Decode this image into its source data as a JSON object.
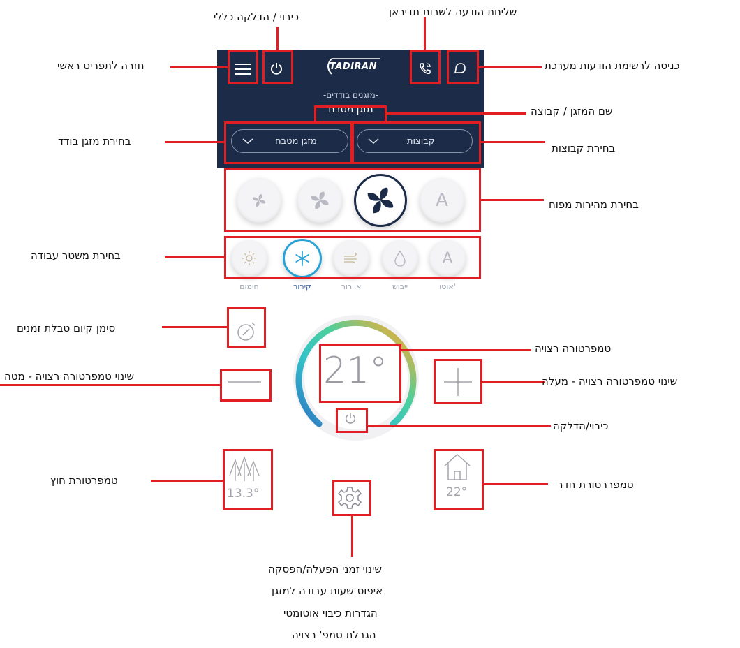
{
  "header": {
    "brand": "TADIRAN",
    "group_caption": "-מזגנים בודדים-",
    "ac_name": "מזגן מטבח",
    "dropdown_single": "מזגן מטבח",
    "dropdown_groups": "קבוצות"
  },
  "fan_speeds": [
    "fan-low",
    "fan-medium",
    "fan-high",
    "auto"
  ],
  "fan_auto_label": "A",
  "modes": {
    "labels": [
      "חימום",
      "קירור",
      "אוורור",
      "ייבוש",
      "אוטו'"
    ],
    "auto_glyph": "A",
    "active": "קירור"
  },
  "thermostat": {
    "set_temp": "21°",
    "outside_temp": "13.3°",
    "room_temp": "22°"
  },
  "annotations": {
    "power_all": "כיבוי / הדלקה כללי",
    "send_message": "שליחת הודעה לשרות תדיראן",
    "back_main": "חזרה לתפריט ראשי",
    "system_messages": "כניסה לרשימת הודעות מערכת",
    "ac_group_name": "שם המזגן / קבוצה",
    "select_single": "בחירת מזגן בודד",
    "select_groups": "בחירת קבוצות",
    "fan_speed": "בחירת מהירות מפוח",
    "work_mode": "בחירת משטר עבודה",
    "timer_indicator": "סימן קיום טבלת זמנים",
    "desired_temp": "טמפרטורה רצויה",
    "temp_down": "שינוי טמפרטורה רצויה - מטה",
    "temp_up": "שינוי טמפרטורה רצויה - מעלה",
    "power_toggle": "כיבוי/הדלקה",
    "outside_temp": "טמפרטורת חוץ",
    "room_temp": "טמפררטורת חדר",
    "settings_lines": [
      "שינוי זמני הפעלה/הפסקה",
      "איפוס שעות עבודה למזגן",
      "הגדרות כיבוי אוטומטי",
      "הגבלת טמפ' רצויה"
    ]
  },
  "colors": {
    "header_bg": "#1c2b48",
    "annotation_red": "#e01e24",
    "active_blue": "#2a5ba8"
  }
}
